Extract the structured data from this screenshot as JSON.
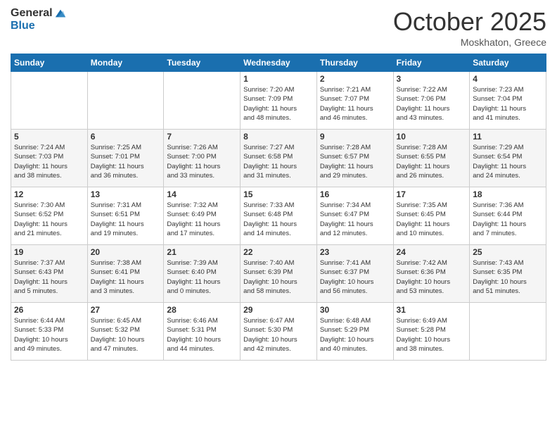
{
  "logo": {
    "general": "General",
    "blue": "Blue"
  },
  "title": "October 2025",
  "subtitle": "Moskhaton, Greece",
  "days_of_week": [
    "Sunday",
    "Monday",
    "Tuesday",
    "Wednesday",
    "Thursday",
    "Friday",
    "Saturday"
  ],
  "weeks": [
    [
      {
        "day": "",
        "info": ""
      },
      {
        "day": "",
        "info": ""
      },
      {
        "day": "",
        "info": ""
      },
      {
        "day": "1",
        "info": "Sunrise: 7:20 AM\nSunset: 7:09 PM\nDaylight: 11 hours\nand 48 minutes."
      },
      {
        "day": "2",
        "info": "Sunrise: 7:21 AM\nSunset: 7:07 PM\nDaylight: 11 hours\nand 46 minutes."
      },
      {
        "day": "3",
        "info": "Sunrise: 7:22 AM\nSunset: 7:06 PM\nDaylight: 11 hours\nand 43 minutes."
      },
      {
        "day": "4",
        "info": "Sunrise: 7:23 AM\nSunset: 7:04 PM\nDaylight: 11 hours\nand 41 minutes."
      }
    ],
    [
      {
        "day": "5",
        "info": "Sunrise: 7:24 AM\nSunset: 7:03 PM\nDaylight: 11 hours\nand 38 minutes."
      },
      {
        "day": "6",
        "info": "Sunrise: 7:25 AM\nSunset: 7:01 PM\nDaylight: 11 hours\nand 36 minutes."
      },
      {
        "day": "7",
        "info": "Sunrise: 7:26 AM\nSunset: 7:00 PM\nDaylight: 11 hours\nand 33 minutes."
      },
      {
        "day": "8",
        "info": "Sunrise: 7:27 AM\nSunset: 6:58 PM\nDaylight: 11 hours\nand 31 minutes."
      },
      {
        "day": "9",
        "info": "Sunrise: 7:28 AM\nSunset: 6:57 PM\nDaylight: 11 hours\nand 29 minutes."
      },
      {
        "day": "10",
        "info": "Sunrise: 7:28 AM\nSunset: 6:55 PM\nDaylight: 11 hours\nand 26 minutes."
      },
      {
        "day": "11",
        "info": "Sunrise: 7:29 AM\nSunset: 6:54 PM\nDaylight: 11 hours\nand 24 minutes."
      }
    ],
    [
      {
        "day": "12",
        "info": "Sunrise: 7:30 AM\nSunset: 6:52 PM\nDaylight: 11 hours\nand 21 minutes."
      },
      {
        "day": "13",
        "info": "Sunrise: 7:31 AM\nSunset: 6:51 PM\nDaylight: 11 hours\nand 19 minutes."
      },
      {
        "day": "14",
        "info": "Sunrise: 7:32 AM\nSunset: 6:49 PM\nDaylight: 11 hours\nand 17 minutes."
      },
      {
        "day": "15",
        "info": "Sunrise: 7:33 AM\nSunset: 6:48 PM\nDaylight: 11 hours\nand 14 minutes."
      },
      {
        "day": "16",
        "info": "Sunrise: 7:34 AM\nSunset: 6:47 PM\nDaylight: 11 hours\nand 12 minutes."
      },
      {
        "day": "17",
        "info": "Sunrise: 7:35 AM\nSunset: 6:45 PM\nDaylight: 11 hours\nand 10 minutes."
      },
      {
        "day": "18",
        "info": "Sunrise: 7:36 AM\nSunset: 6:44 PM\nDaylight: 11 hours\nand 7 minutes."
      }
    ],
    [
      {
        "day": "19",
        "info": "Sunrise: 7:37 AM\nSunset: 6:43 PM\nDaylight: 11 hours\nand 5 minutes."
      },
      {
        "day": "20",
        "info": "Sunrise: 7:38 AM\nSunset: 6:41 PM\nDaylight: 11 hours\nand 3 minutes."
      },
      {
        "day": "21",
        "info": "Sunrise: 7:39 AM\nSunset: 6:40 PM\nDaylight: 11 hours\nand 0 minutes."
      },
      {
        "day": "22",
        "info": "Sunrise: 7:40 AM\nSunset: 6:39 PM\nDaylight: 10 hours\nand 58 minutes."
      },
      {
        "day": "23",
        "info": "Sunrise: 7:41 AM\nSunset: 6:37 PM\nDaylight: 10 hours\nand 56 minutes."
      },
      {
        "day": "24",
        "info": "Sunrise: 7:42 AM\nSunset: 6:36 PM\nDaylight: 10 hours\nand 53 minutes."
      },
      {
        "day": "25",
        "info": "Sunrise: 7:43 AM\nSunset: 6:35 PM\nDaylight: 10 hours\nand 51 minutes."
      }
    ],
    [
      {
        "day": "26",
        "info": "Sunrise: 6:44 AM\nSunset: 5:33 PM\nDaylight: 10 hours\nand 49 minutes."
      },
      {
        "day": "27",
        "info": "Sunrise: 6:45 AM\nSunset: 5:32 PM\nDaylight: 10 hours\nand 47 minutes."
      },
      {
        "day": "28",
        "info": "Sunrise: 6:46 AM\nSunset: 5:31 PM\nDaylight: 10 hours\nand 44 minutes."
      },
      {
        "day": "29",
        "info": "Sunrise: 6:47 AM\nSunset: 5:30 PM\nDaylight: 10 hours\nand 42 minutes."
      },
      {
        "day": "30",
        "info": "Sunrise: 6:48 AM\nSunset: 5:29 PM\nDaylight: 10 hours\nand 40 minutes."
      },
      {
        "day": "31",
        "info": "Sunrise: 6:49 AM\nSunset: 5:28 PM\nDaylight: 10 hours\nand 38 minutes."
      },
      {
        "day": "",
        "info": ""
      }
    ]
  ]
}
